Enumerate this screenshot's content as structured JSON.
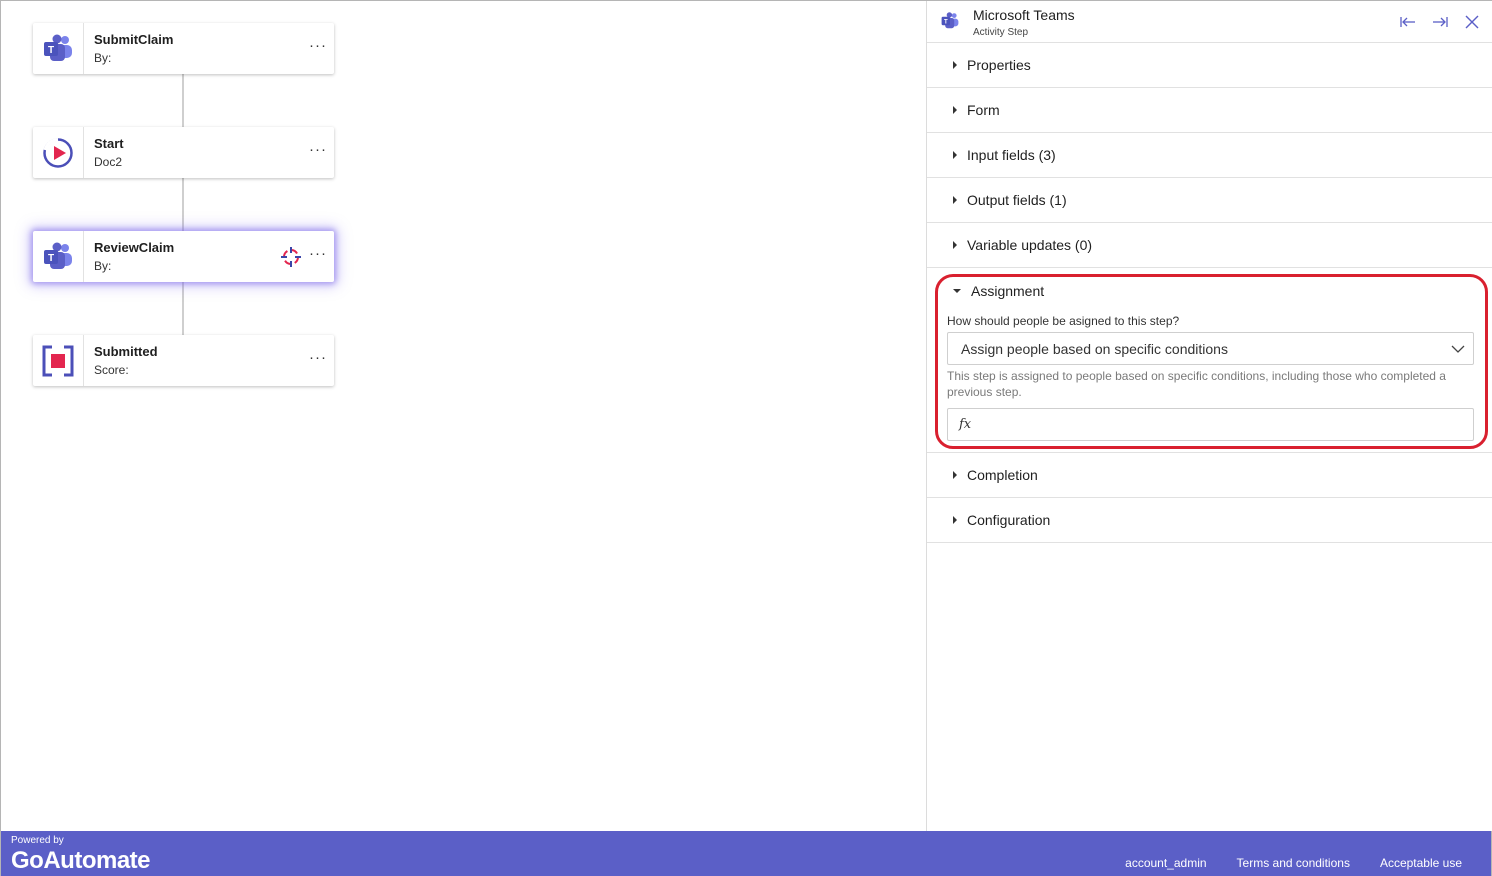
{
  "canvas": {
    "nodes": [
      {
        "title": "SubmitClaim",
        "subtitle": "By:",
        "icon": "teams-icon",
        "selected": false
      },
      {
        "title": "Start",
        "subtitle": "Doc2",
        "icon": "play-circle-icon",
        "selected": false
      },
      {
        "title": "ReviewClaim",
        "subtitle": "By:",
        "icon": "teams-icon",
        "selected": true
      },
      {
        "title": "Submitted",
        "subtitle": "Score:",
        "icon": "stop-square-icon",
        "selected": false
      }
    ],
    "more_label": "···"
  },
  "panel": {
    "title": "Microsoft Teams",
    "subtitle": "Activity Step",
    "sections_top": [
      {
        "label": "Properties"
      },
      {
        "label": "Form"
      },
      {
        "label": "Input fields (3)"
      },
      {
        "label": "Output fields (1)"
      },
      {
        "label": "Variable updates (0)"
      }
    ],
    "assignment": {
      "label": "Assignment",
      "question": "How should people be asigned to this step?",
      "selected_option": "Assign people based on specific conditions",
      "help": "This step is assigned to people based on specific conditions, including those who completed a previous step.",
      "formula_symbol": "fx",
      "formula_value": ""
    },
    "sections_bottom": [
      {
        "label": "Completion"
      },
      {
        "label": "Configuration"
      }
    ]
  },
  "footer": {
    "powered_by": "Powered by",
    "logo": "GoAutomate",
    "links": [
      "account_admin",
      "Terms and conditions",
      "Acceptable use"
    ]
  },
  "colors": {
    "brand": "#5b5fc7",
    "highlight": "#d9202f",
    "teams": "#5b5fc7"
  }
}
